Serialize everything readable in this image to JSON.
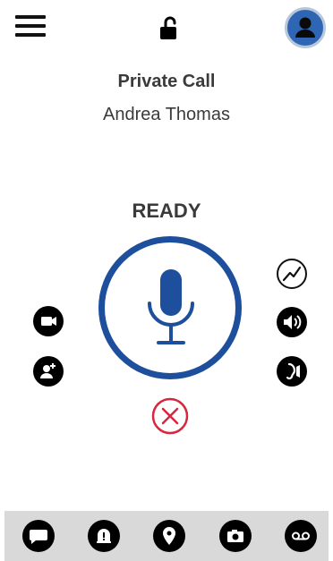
{
  "header": {
    "menu_icon": "hamburger-menu-icon",
    "lock_icon": "unlocked-padlock-icon",
    "avatar_icon": "user-avatar-icon"
  },
  "call": {
    "type": "Private Call",
    "contact": "Andrea Thomas",
    "status": "READY"
  },
  "left_actions": [
    {
      "icon": "video-camera-icon"
    },
    {
      "icon": "add-user-icon"
    }
  ],
  "right_actions": [
    {
      "icon": "signal-activity-icon"
    },
    {
      "icon": "speaker-volume-icon"
    },
    {
      "icon": "earpiece-icon"
    }
  ],
  "ptt_icon": "microphone-icon",
  "cancel_icon": "cancel-x-icon",
  "bottom_tabs": [
    {
      "icon": "chat-bubble-icon"
    },
    {
      "icon": "alert-bell-icon"
    },
    {
      "icon": "location-pin-icon"
    },
    {
      "icon": "camera-icon"
    },
    {
      "icon": "voicemail-icon"
    }
  ],
  "colors": {
    "accent": "#1d4f9c",
    "cancel": "#d7263d",
    "bottom_bar": "#d9d9d9"
  }
}
